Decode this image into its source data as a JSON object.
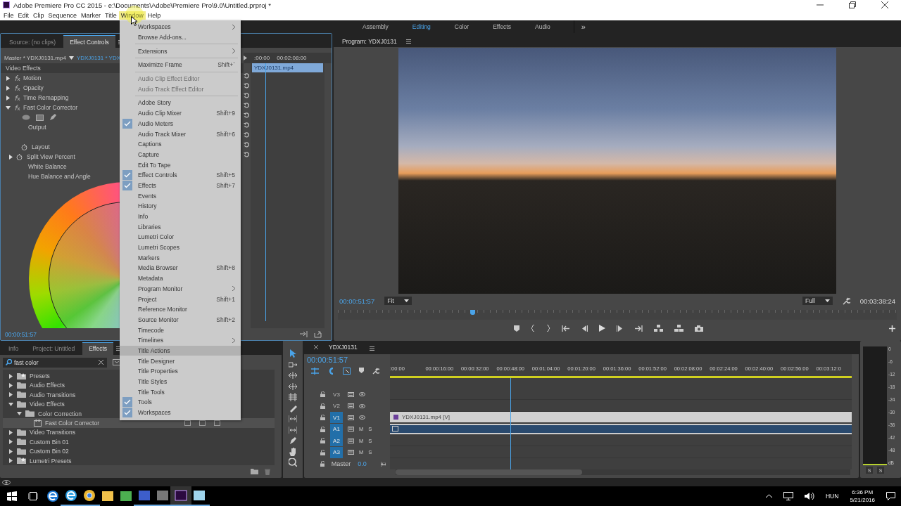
{
  "window": {
    "title": "Adobe Premiere Pro CC 2015 - e:\\Documents\\Adobe\\Premiere Pro\\9.0\\Untitled.prproj *"
  },
  "menu_bar": [
    {
      "label": "File",
      "selected": false
    },
    {
      "label": "Edit",
      "selected": false
    },
    {
      "label": "Clip",
      "selected": false
    },
    {
      "label": "Sequence",
      "selected": false
    },
    {
      "label": "Marker",
      "selected": false
    },
    {
      "label": "Title",
      "selected": false
    },
    {
      "label": "Window",
      "selected": true
    },
    {
      "label": "Help",
      "selected": false
    }
  ],
  "workspaces": {
    "tabs": [
      {
        "label": "Assembly",
        "selected": false
      },
      {
        "label": "Editing",
        "selected": true
      },
      {
        "label": "Color",
        "selected": false
      },
      {
        "label": "Effects",
        "selected": false
      },
      {
        "label": "Audio",
        "selected": false
      }
    ],
    "more": "»"
  },
  "window_menu": {
    "groups": [
      [
        {
          "label": "Workspaces",
          "checked": false,
          "disabled": false,
          "submenu": true,
          "selected": false
        },
        {
          "label": "Browse Add-ons...",
          "checked": false,
          "disabled": false,
          "submenu": false,
          "selected": false
        }
      ],
      [
        {
          "label": "Extensions",
          "checked": false,
          "disabled": false,
          "submenu": true,
          "selected": false
        }
      ],
      [
        {
          "label": "Maximize Frame",
          "shortcut": "Shift+`",
          "checked": false,
          "disabled": false,
          "submenu": false,
          "selected": false
        }
      ],
      [
        {
          "label": "Audio Clip Effect Editor",
          "checked": false,
          "disabled": true,
          "submenu": false,
          "selected": false
        },
        {
          "label": "Audio Track Effect Editor",
          "checked": false,
          "disabled": true,
          "submenu": false,
          "selected": false
        }
      ],
      [
        {
          "label": "Adobe Story",
          "checked": false,
          "disabled": false,
          "submenu": false,
          "selected": false
        },
        {
          "label": "Audio Clip Mixer",
          "shortcut": "Shift+9",
          "checked": false,
          "disabled": false,
          "submenu": false,
          "selected": false
        },
        {
          "label": "Audio Meters",
          "checked": true,
          "disabled": false,
          "submenu": false,
          "selected": false
        },
        {
          "label": "Audio Track Mixer",
          "shortcut": "Shift+6",
          "checked": false,
          "disabled": false,
          "submenu": false,
          "selected": false
        },
        {
          "label": "Captions",
          "checked": false,
          "disabled": false,
          "submenu": false,
          "selected": false
        },
        {
          "label": "Capture",
          "checked": false,
          "disabled": false,
          "submenu": false,
          "selected": false
        },
        {
          "label": "Edit To Tape",
          "checked": false,
          "disabled": false,
          "submenu": false,
          "selected": false
        },
        {
          "label": "Effect Controls",
          "shortcut": "Shift+5",
          "checked": true,
          "disabled": false,
          "submenu": false,
          "selected": false
        },
        {
          "label": "Effects",
          "shortcut": "Shift+7",
          "checked": true,
          "disabled": false,
          "submenu": false,
          "selected": false
        },
        {
          "label": "Events",
          "checked": false,
          "disabled": false,
          "submenu": false,
          "selected": false
        },
        {
          "label": "History",
          "checked": false,
          "disabled": false,
          "submenu": false,
          "selected": false
        },
        {
          "label": "Info",
          "checked": false,
          "disabled": false,
          "submenu": false,
          "selected": false
        },
        {
          "label": "Libraries",
          "checked": false,
          "disabled": false,
          "submenu": false,
          "selected": false
        },
        {
          "label": "Lumetri Color",
          "checked": false,
          "disabled": false,
          "submenu": false,
          "selected": false
        },
        {
          "label": "Lumetri Scopes",
          "checked": false,
          "disabled": false,
          "submenu": false,
          "selected": false
        },
        {
          "label": "Markers",
          "checked": false,
          "disabled": false,
          "submenu": false,
          "selected": false
        },
        {
          "label": "Media Browser",
          "shortcut": "Shift+8",
          "checked": false,
          "disabled": false,
          "submenu": false,
          "selected": false
        },
        {
          "label": "Metadata",
          "checked": false,
          "disabled": false,
          "submenu": false,
          "selected": false
        },
        {
          "label": "Program Monitor",
          "checked": false,
          "disabled": false,
          "submenu": true,
          "selected": false
        },
        {
          "label": "Project",
          "shortcut": "Shift+1",
          "checked": false,
          "disabled": false,
          "submenu": false,
          "selected": false
        },
        {
          "label": "Reference Monitor",
          "checked": false,
          "disabled": false,
          "submenu": false,
          "selected": false
        },
        {
          "label": "Source Monitor",
          "shortcut": "Shift+2",
          "checked": false,
          "disabled": false,
          "submenu": false,
          "selected": false
        },
        {
          "label": "Timecode",
          "checked": false,
          "disabled": false,
          "submenu": false,
          "selected": false
        },
        {
          "label": "Timelines",
          "checked": false,
          "disabled": false,
          "submenu": true,
          "selected": false
        },
        {
          "label": "Title Actions",
          "checked": false,
          "disabled": false,
          "submenu": false,
          "selected": true
        },
        {
          "label": "Title Designer",
          "checked": false,
          "disabled": false,
          "submenu": false,
          "selected": false
        },
        {
          "label": "Title Properties",
          "checked": false,
          "disabled": false,
          "submenu": false,
          "selected": false
        },
        {
          "label": "Title Styles",
          "checked": false,
          "disabled": false,
          "submenu": false,
          "selected": false
        },
        {
          "label": "Title Tools",
          "checked": false,
          "disabled": false,
          "submenu": false,
          "selected": false
        },
        {
          "label": "Tools",
          "checked": true,
          "disabled": false,
          "submenu": false,
          "selected": false
        },
        {
          "label": "Workspaces",
          "checked": true,
          "disabled": false,
          "submenu": false,
          "selected": false
        }
      ]
    ]
  },
  "effect_controls": {
    "tabs": [
      {
        "label": "Source: (no clips)",
        "selected": false
      },
      {
        "label": "Effect Controls",
        "selected": true
      }
    ],
    "master_clip": "Master * YDXJ0131.mp4",
    "sequence_clip": "YDXJ0131 * YDX",
    "ruler": [
      ":00:00",
      "00:02:08:00"
    ],
    "clip": "YDXJ0131.mp4",
    "playhead": {
      "level": 0.2
    },
    "rows": [
      {
        "kind": "section",
        "label": "Video Effects"
      },
      {
        "kind": "effect",
        "label": "Motion",
        "expanded": false
      },
      {
        "kind": "effect",
        "label": "Opacity",
        "expanded": false
      },
      {
        "kind": "effect",
        "label": "Time Remapping",
        "expanded": false
      },
      {
        "kind": "effect",
        "label": "Fast Color Corrector",
        "expanded": true
      },
      {
        "kind": "masks"
      },
      {
        "kind": "property",
        "label": "Output"
      },
      {
        "kind": "spacer"
      },
      {
        "kind": "animatable",
        "label": "Layout"
      },
      {
        "kind": "animatable",
        "label": "Split View Percent",
        "expanded": false
      },
      {
        "kind": "property",
        "label": "White Balance"
      },
      {
        "kind": "property",
        "label": "Hue Balance and Angle"
      }
    ],
    "timecode": "00:00:51:57"
  },
  "program_monitor": {
    "tab": "Program: YDXJ0131",
    "timecode": "00:00:51:57",
    "zoom": "Fit",
    "resolution": "Full",
    "duration": "00:03:38:24",
    "playhead": {
      "level": 0.24
    }
  },
  "effects_panel": {
    "tabs": [
      {
        "label": "Info",
        "selected": false
      },
      {
        "label": "Project: Untitled",
        "selected": false
      },
      {
        "label": "Effects",
        "selected": true
      }
    ],
    "search": "fast color",
    "tree": [
      {
        "label": "Presets",
        "kind": "preset_folder",
        "expanded": false,
        "selected": false
      },
      {
        "label": "Audio Effects",
        "kind": "folder",
        "expanded": false,
        "selected": false
      },
      {
        "label": "Audio Transitions",
        "kind": "folder",
        "expanded": false,
        "selected": false
      },
      {
        "label": "Video Effects",
        "kind": "folder",
        "expanded": true,
        "selected": false,
        "children": [
          {
            "label": "Color Correction",
            "kind": "folder",
            "expanded": true,
            "selected": false,
            "children": [
              {
                "label": "Fast Color Corrector",
                "kind": "effect",
                "selected": true
              }
            ]
          }
        ]
      },
      {
        "label": "Video Transitions",
        "kind": "folder",
        "expanded": false,
        "selected": false
      },
      {
        "label": "Custom Bin 01",
        "kind": "folder",
        "expanded": false,
        "selected": false
      },
      {
        "label": "Custom Bin 02",
        "kind": "folder",
        "expanded": false,
        "selected": false
      },
      {
        "label": "Lumetri Presets",
        "kind": "preset_folder",
        "expanded": false,
        "selected": false
      }
    ]
  },
  "timeline": {
    "tab": "YDXJ0131",
    "timecode": "00:00:51:57",
    "ruler": [
      ":00:00",
      "00:00:16:00",
      "00:00:32:00",
      "00:00:48:00",
      "00:01:04:00",
      "00:01:20:00",
      "00:01:36:00",
      "00:01:52:00",
      "00:02:08:00",
      "00:02:24:00",
      "00:02:40:00",
      "00:02:56:00",
      "00:03:12:0"
    ],
    "playhead": {
      "level": 0.26
    },
    "tracks": [
      {
        "name": "V3",
        "kind": "video",
        "targeted": false
      },
      {
        "name": "V2",
        "kind": "video",
        "targeted": false
      },
      {
        "name": "V1",
        "kind": "video",
        "targeted": true,
        "clip": {
          "label": "YDXJ0131.mp4 [V]"
        }
      },
      {
        "name": "A1",
        "kind": "audio",
        "targeted": true,
        "clip": {
          "effects_badge": true
        },
        "mute": "M",
        "solo": "S"
      },
      {
        "name": "A2",
        "kind": "audio",
        "targeted": true,
        "mute": "M",
        "solo": "S"
      },
      {
        "name": "A3",
        "kind": "audio",
        "targeted": true,
        "mute": "M",
        "solo": "S"
      }
    ],
    "master": {
      "label": "Master",
      "value": "0.0"
    }
  },
  "audio_meter": {
    "scale": [
      "0",
      "-6",
      "-12",
      "-18",
      "-24",
      "-30",
      "-36",
      "-42",
      "-48",
      "dB"
    ],
    "solo": [
      "S",
      "S"
    ]
  },
  "taskbar": {
    "apps": [
      {
        "kind": "edge",
        "running": false,
        "active": false
      },
      {
        "kind": "ie",
        "running": true,
        "active": false
      },
      {
        "kind": "chrome",
        "running": true,
        "active": false
      },
      {
        "kind": "explorer",
        "running": false,
        "active": false
      },
      {
        "kind": "camtasia",
        "running": false,
        "active": false
      },
      {
        "kind": "floppy",
        "running": true,
        "active": false
      },
      {
        "kind": "tool",
        "running": true,
        "active": false
      },
      {
        "kind": "premiere",
        "running": true,
        "active": true
      },
      {
        "kind": "notes",
        "running": true,
        "active": false
      }
    ],
    "language": "HUN",
    "time": "6:36 PM",
    "date": "5/21/2016"
  }
}
